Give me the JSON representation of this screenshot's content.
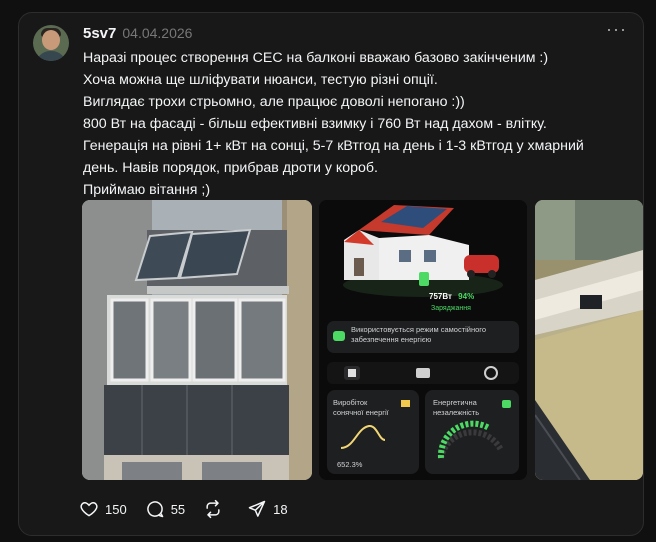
{
  "post": {
    "username": "5sv7",
    "date": "04.04.2026",
    "more_label": "···",
    "lines": [
      "Наразі процес створення СЕС на балконі вважаю базово закінченим :)",
      "Хоча можна ще шліфувати нюанси, тестую різні опції.",
      "Виглядає трохи стрьомно, але працює доволі непогано :))",
      "800 Вт на фасаді - більш ефективні взимку і 760 Вт над дахом - влітку.",
      "Генерація на рівні 1+ кВт на сонці, 5-7 кВтгод на день і 1-3 кВтгод у хмарний",
      "день. Навів порядок, прибрав дроти у короб.",
      "Приймаю вітання ;)"
    ]
  },
  "app_screenshot": {
    "power": "757Вт",
    "battery": "94%",
    "status": "Заряджання",
    "notice_line1": "Використовується режим самостійного",
    "notice_line2": "забезпечення енергією",
    "card1_line1": "Виробіток",
    "card1_line2": "сонячної енергії",
    "card1_value": "652.3%",
    "card2_line1": "Енергетична",
    "card2_line2": "незалежність"
  },
  "actions": {
    "likes": "150",
    "comments": "55",
    "reposts": "",
    "shares": "18"
  },
  "colors": {
    "accent_green": "#4cd964",
    "background": "#101010",
    "card": "#181818"
  }
}
